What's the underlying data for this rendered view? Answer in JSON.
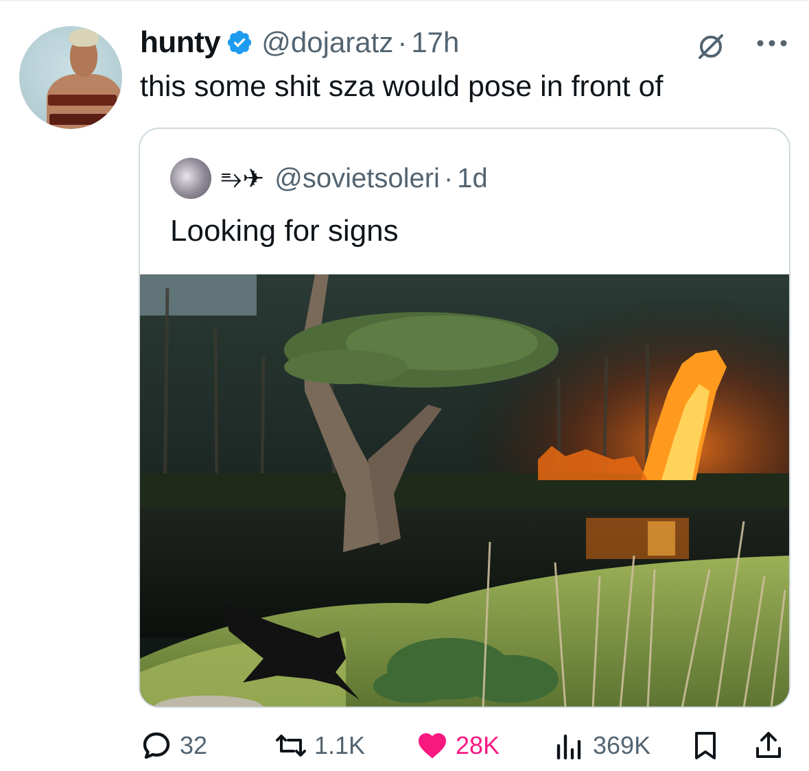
{
  "tweet": {
    "author_name": "hunty",
    "author_handle": "@dojaratz",
    "dot": "·",
    "time": "17h",
    "text": "this some shit sza would pose in front of",
    "verified": true
  },
  "quote": {
    "author_name": "⥱✈",
    "author_handle": "@sovietsoleri",
    "dot": "·",
    "time": "1d",
    "text": "Looking for signs"
  },
  "actions": {
    "replies": "32",
    "reposts": "1.1K",
    "likes": "28K",
    "views": "369K"
  },
  "icons": {
    "verified": "verified-badge-icon",
    "grok": "grok-icon",
    "more": "more-icon",
    "reply": "reply-icon",
    "repost": "repost-icon",
    "like": "heart-icon",
    "views": "views-icon",
    "bookmark": "bookmark-icon",
    "share": "share-icon"
  },
  "colors": {
    "text": "#0f1419",
    "secondary": "#536471",
    "verified": "#1d9bf0",
    "like": "#f91880",
    "border": "#cfd9de"
  }
}
